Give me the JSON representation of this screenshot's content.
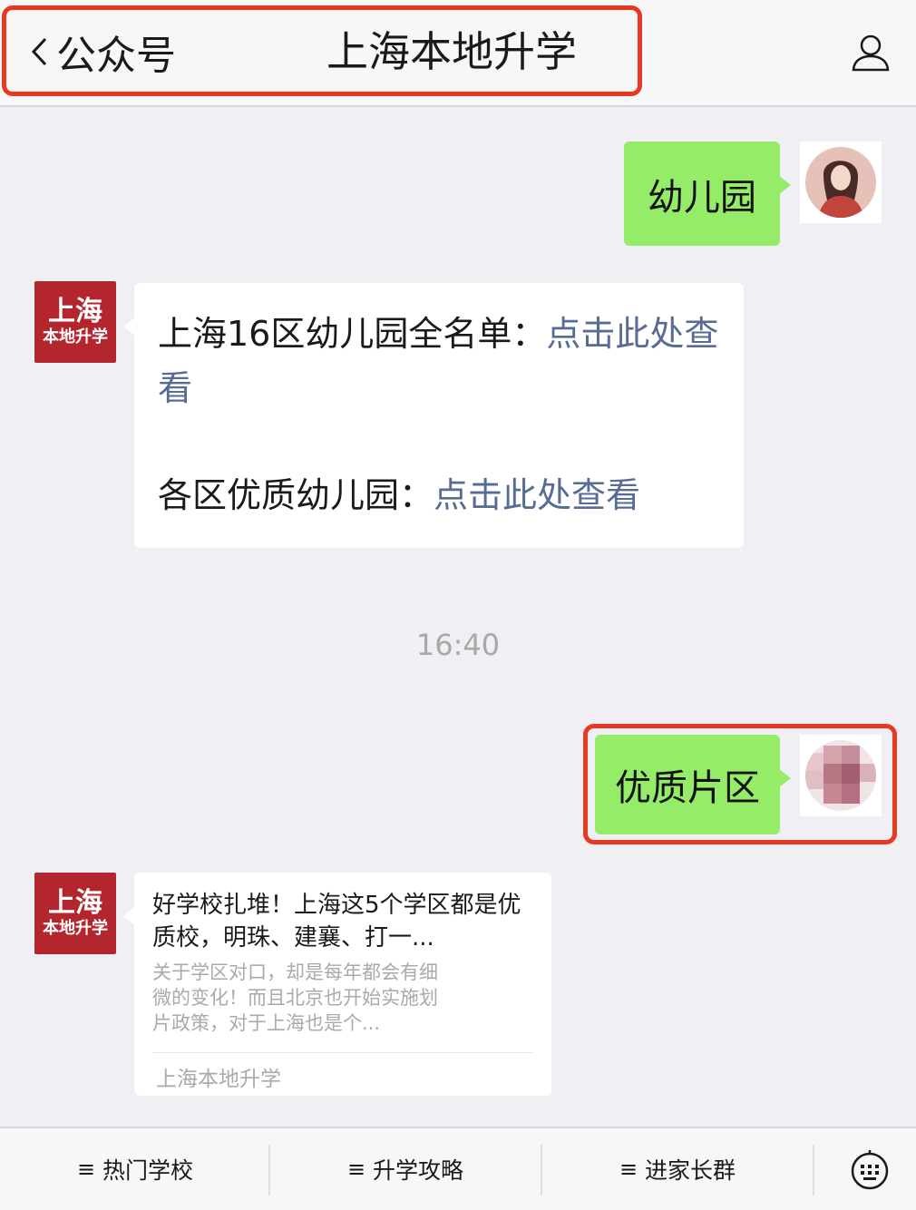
{
  "header": {
    "back_label": "公众号",
    "title": "上海本地升学"
  },
  "messages": {
    "m1_text": "幼儿园",
    "m2_line1_text": "上海16区幼儿园全名单：",
    "m2_line1_link": "点击此处查看",
    "m2_line2_text": "各区优质幼儿园：",
    "m2_line2_link": "点击此处查看",
    "time": "16:40",
    "m3_text": "优质片区",
    "card_title": "好学校扎堆！上海这5个学区都是优质校，明珠、建襄、打一...",
    "card_desc": "关于学区对口，却是每年都会有细微的变化！而且北京也开始实施划片政策，对于上海也是个...",
    "card_source": "上海本地升学"
  },
  "org_avatar": {
    "line1": "上海",
    "line2": "本地升学"
  },
  "bottom_menu": [
    "热门学校",
    "升学攻略",
    "进家长群"
  ],
  "colors": {
    "highlight": "#e8381f",
    "user_bubble": "#95ec69",
    "link": "#576b95",
    "org_avatar": "#b3262d"
  }
}
